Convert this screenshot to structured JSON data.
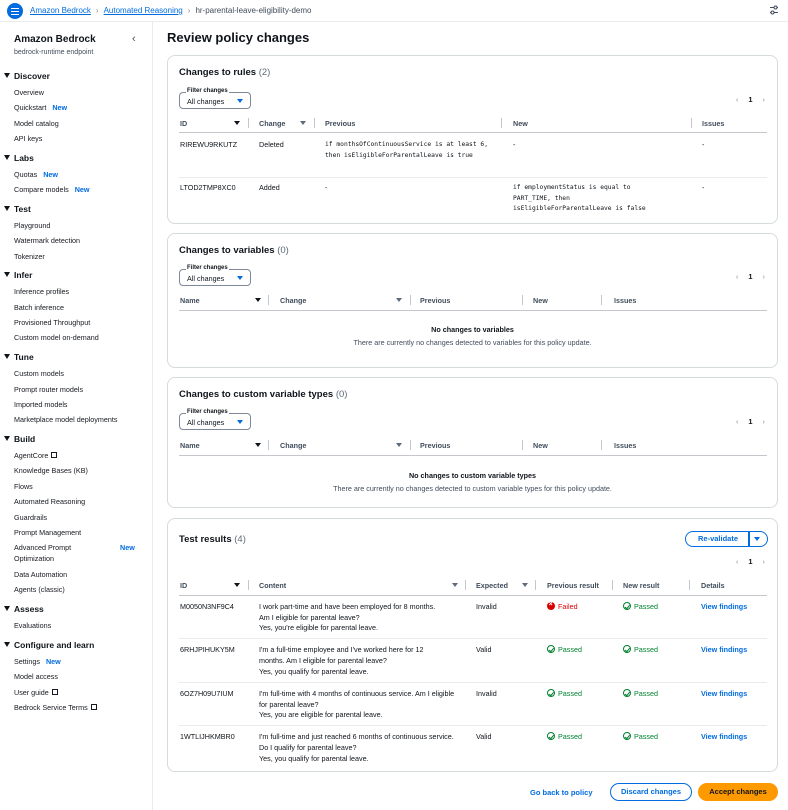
{
  "breadcrumb": {
    "items": [
      "Amazon Bedrock",
      "Automated Reasoning"
    ],
    "current": "hr-parental-leave-eligibility-demo"
  },
  "sidebar": {
    "title": "Amazon Bedrock",
    "subtitle": "bedrock-runtime endpoint",
    "new_badge": "New",
    "sections": [
      {
        "label": "Discover",
        "items": [
          "Overview",
          "Quickstart",
          "Model catalog",
          "API keys"
        ]
      },
      {
        "label": "Labs",
        "items": [
          "Quotas",
          "Compare models"
        ]
      },
      {
        "label": "Test",
        "items": [
          "Playground",
          "Watermark detection",
          "Tokenizer"
        ]
      },
      {
        "label": "Infer",
        "items": [
          "Inference profiles",
          "Batch inference",
          "Provisioned Throughput",
          "Custom model on-demand"
        ]
      },
      {
        "label": "Tune",
        "items": [
          "Custom models",
          "Prompt router models",
          "Imported models",
          "Marketplace model deployments"
        ]
      },
      {
        "label": "Build",
        "items": [
          "AgentCore",
          "Knowledge Bases (KB)",
          "Flows",
          "Automated Reasoning",
          "Guardrails",
          "Prompt Management",
          "Advanced Prompt",
          "Optimization",
          "Data Automation",
          "Agents (classic)"
        ]
      },
      {
        "label": "Assess",
        "items": [
          "Evaluations"
        ]
      },
      {
        "label": "Configure and learn",
        "items": [
          "Settings",
          "Model access",
          "User guide",
          "Bedrock Service Terms"
        ]
      }
    ]
  },
  "page": {
    "title": "Review policy changes"
  },
  "filter": {
    "label": "Filter changes",
    "value": "All changes"
  },
  "pagination": {
    "prev": "‹",
    "page": "1",
    "next": "›"
  },
  "rules": {
    "title": "Changes to rules",
    "count": "(2)",
    "columns": [
      "ID",
      "Change",
      "Previous",
      "New",
      "Issues"
    ],
    "rows": [
      {
        "id": "RIREWU9RKUTZ",
        "change": "Deleted",
        "previous": "if monthsOfContinuousService is at least 6, then isEligibleForParentalLeave is true",
        "new": "-",
        "issues": "-"
      },
      {
        "id": "LTOD2TMP8XC0",
        "change": "Added",
        "previous": "-",
        "new": "if employmentStatus is equal to PART_TIME, then isEligibleForParentalLeave is false",
        "issues": "-"
      }
    ]
  },
  "variables": {
    "title": "Changes to variables",
    "count": "(0)",
    "columns": [
      "Name",
      "Change",
      "Previous",
      "New",
      "Issues"
    ],
    "empty_title": "No changes to variables",
    "empty_desc": "There are currently no changes detected to variables for this policy update."
  },
  "custom_types": {
    "title": "Changes to custom variable types",
    "count": "(0)",
    "columns": [
      "Name",
      "Change",
      "Previous",
      "New",
      "Issues"
    ],
    "empty_title": "No changes to custom variable types",
    "empty_desc": "There are currently no changes detected to custom variable types for this policy update."
  },
  "tests": {
    "title": "Test results",
    "count": "(4)",
    "revalidate": "Re-validate",
    "columns": [
      "ID",
      "Content",
      "Expected",
      "Previous result",
      "New result",
      "Details"
    ],
    "rows": [
      {
        "id": "M0050N3NF9C4",
        "content": "I work part-time and have been employed for 8 months. Am I eligible for parental leave?",
        "answer": "Yes, you're eligible for parental leave.",
        "expected": "Invalid",
        "previous": "Failed",
        "new": "Passed",
        "details": "View findings"
      },
      {
        "id": "6RHJPIHUKY5M",
        "content": "I'm a full-time employee and I've worked here for 12 months. Am I eligible for parental leave?",
        "answer": "Yes, you qualify for parental leave.",
        "expected": "Valid",
        "previous": "Passed",
        "new": "Passed",
        "details": "View findings"
      },
      {
        "id": "6OZ7H09U7IUM",
        "content": "I'm full-time with 4 months of continuous service. Am I eligible for parental leave?",
        "answer": "Yes, you are eligible for parental leave.",
        "expected": "Invalid",
        "previous": "Passed",
        "new": "Passed",
        "details": "View findings"
      },
      {
        "id": "1WTLIJHKMBR0",
        "content": "I'm full-time and just reached 6 months of continuous service. Do I qualify for parental leave?",
        "answer": "Yes, you qualify for parental leave.",
        "expected": "Valid",
        "previous": "Passed",
        "new": "Passed",
        "details": "View findings"
      }
    ]
  },
  "footer": {
    "back": "Go back to policy",
    "discard": "Discard changes",
    "accept": "Accept changes"
  },
  "colors": {
    "accent": "#006ce0",
    "primary_button": "#ff9900",
    "success": "#00802f",
    "error": "#db0000"
  }
}
